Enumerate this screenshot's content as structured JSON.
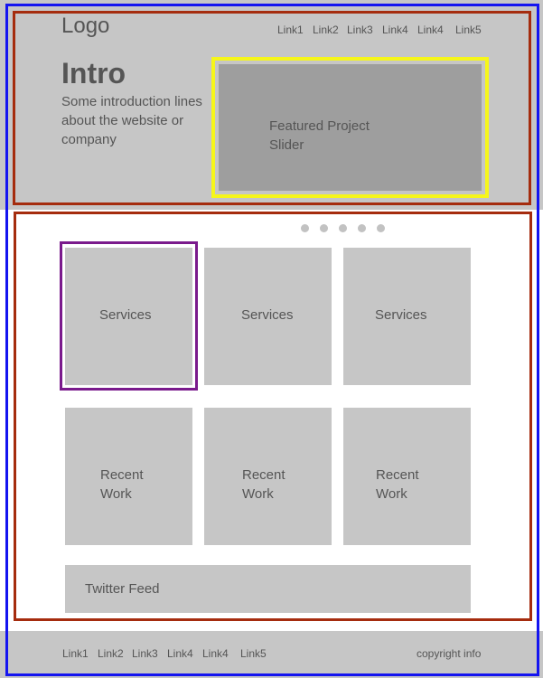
{
  "header": {
    "logo": "Logo",
    "nav_links": [
      "Link1",
      "Link2",
      "Link3",
      "Link4",
      "Link4",
      "Link5"
    ],
    "intro_title": "Intro",
    "intro_text": "Some introduction lines about the website or company",
    "slider": {
      "label_line1": "Featured Project",
      "label_line2": "Slider",
      "dots_count": 5
    }
  },
  "services": [
    {
      "label": "Services"
    },
    {
      "label": "Services"
    },
    {
      "label": "Services"
    }
  ],
  "recent_work": [
    {
      "line1": "Recent",
      "line2": "Work"
    },
    {
      "line1": "Recent",
      "line2": "Work"
    },
    {
      "line1": "Recent",
      "line2": "Work"
    }
  ],
  "twitter": {
    "label": "Twitter Feed"
  },
  "footer": {
    "links": [
      "Link1",
      "Link2",
      "Link3",
      "Link4",
      "Link4",
      "Link5"
    ],
    "copyright": "copyright info"
  },
  "colors": {
    "outer_frame": "#1414f0",
    "section_frame": "#a52c0e",
    "slider_frame": "#f6f61a",
    "services_highlight": "#7a1a8c",
    "block_fill": "#c6c6c6",
    "slider_fill": "#9e9e9e"
  }
}
